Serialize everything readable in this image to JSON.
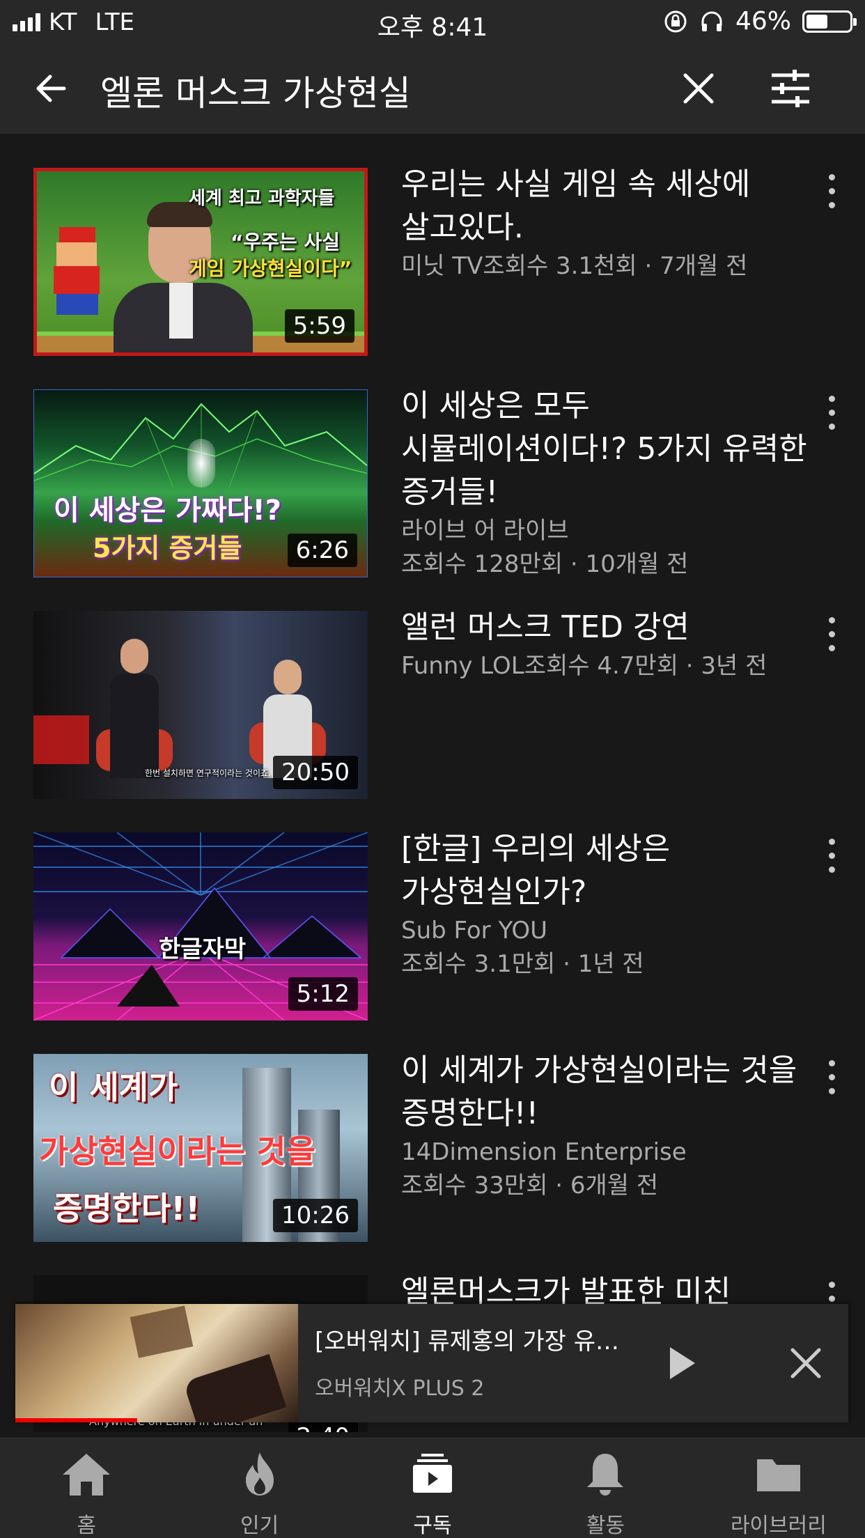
{
  "status_bar": {
    "carrier": "KT",
    "network": "LTE",
    "time": "오후 8:41",
    "battery": "46%"
  },
  "search": {
    "query": "엘론 머스크 가상현실"
  },
  "results": [
    {
      "title": "우리는 사실 게임 속 세상에 살고있다.",
      "meta_line1": "미닛 TV조회수 3.1천회 · 7개월 전",
      "meta_line2": "",
      "duration": "5:59",
      "thumb_text": [
        "세계 최고 과학자들",
        "“우주는 사실",
        "게임 가상현실이다”"
      ]
    },
    {
      "title": "이 세상은 모두 시뮬레이션이다!? 5가지 유력한 증거들!",
      "meta_line1": "라이브 어 라이브",
      "meta_line2": "조회수 128만회 · 10개월 전",
      "duration": "6:26",
      "thumb_text": [
        "이 세상은 가짜다!?",
        "5가지 증거들"
      ]
    },
    {
      "title": "앨런 머스크 TED 강연",
      "meta_line1": "Funny LOL조회수 4.7만회 · 3년 전",
      "meta_line2": "",
      "duration": "20:50",
      "thumb_text": [
        "한번 설치하면 연구적이라는 것이죠."
      ]
    },
    {
      "title": "[한글] 우리의 세상은 가상현실인가?",
      "meta_line1": "Sub For YOU",
      "meta_line2": "조회수 3.1만회 · 1년 전",
      "duration": "5:12",
      "thumb_text": [
        "한글자막"
      ]
    },
    {
      "title": "이 세계가 가상현실이라는 것을 증명한다!!",
      "meta_line1": "14Dimension Enterprise",
      "meta_line2": "조회수 33만회 · 6개월 전",
      "duration": "10:26",
      "thumb_text": [
        "이 세계가",
        "가상현실이라는 것을",
        "증명한다!!"
      ]
    },
    {
      "title": "엘론머스크가 발표한 미친",
      "meta_line1": "",
      "meta_line2": "",
      "duration": "2:40",
      "thumb_text": [
        "Anywhere on Earth in under an"
      ]
    }
  ],
  "mini_player": {
    "title": "[오버워치] 류제홍의 가장 유…",
    "channel": "오버워치X PLUS 2",
    "progress": 0.43
  },
  "bottom_nav": [
    {
      "label": "홈",
      "icon": "home-icon",
      "active": false
    },
    {
      "label": "인기",
      "icon": "fire-icon",
      "active": false
    },
    {
      "label": "구독",
      "icon": "subscriptions-icon",
      "active": true
    },
    {
      "label": "활동",
      "icon": "bell-icon",
      "active": false
    },
    {
      "label": "라이브러리",
      "icon": "folder-icon",
      "active": false
    }
  ],
  "colors": {
    "background": "#181818",
    "header": "#282828",
    "secondary_text": "#aaaaaa",
    "progress": "#ee0000"
  }
}
